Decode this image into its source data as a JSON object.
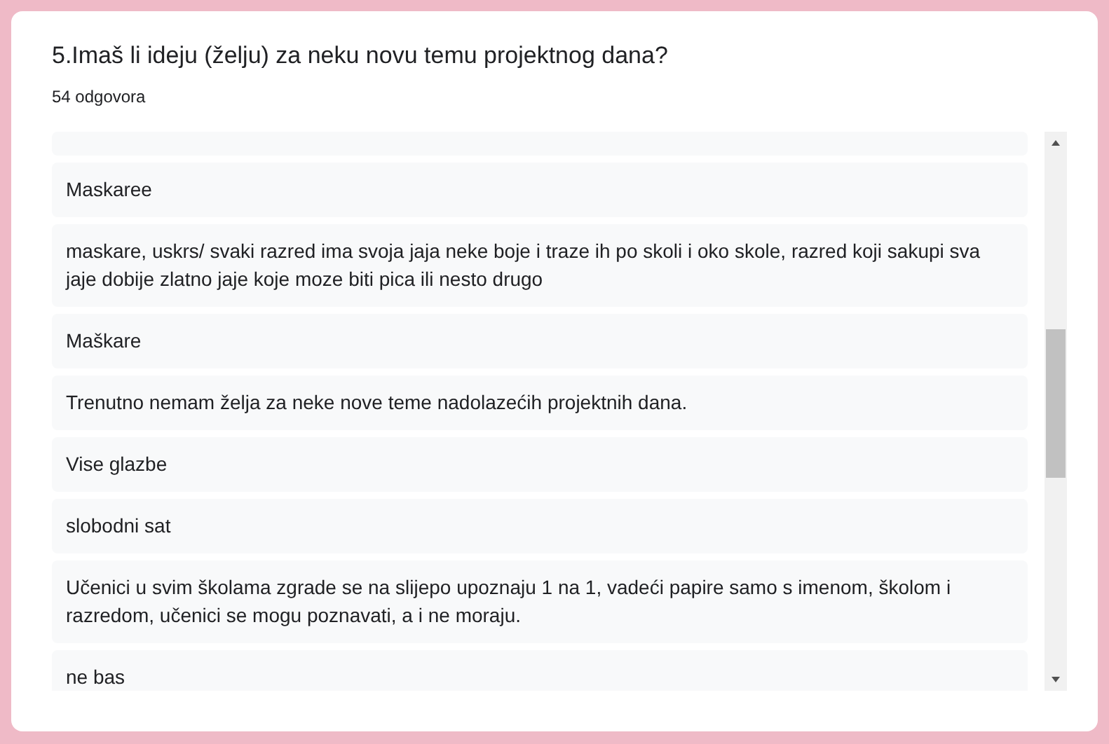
{
  "question": {
    "title": "5.Imaš li ideju (želju) za neku novu temu projektnog dana?",
    "count": "54 odgovora"
  },
  "responses": [
    {
      "text": "Maskaree"
    },
    {
      "text": "maskare, uskrs/ svaki razred ima svoja jaja neke boje i traze ih po skoli i oko skole, razred koji sakupi sva jaje dobije zlatno jaje koje moze biti pica ili nesto drugo"
    },
    {
      "text": "Maškare"
    },
    {
      "text": "Trenutno nemam želja za neke nove teme nadolazećih projektnih dana."
    },
    {
      "text": "Vise glazbe"
    },
    {
      "text": "slobodni sat"
    },
    {
      "text": "Učenici u svim školama zgrade se na slijepo upoznaju 1 na 1, vadeći papire samo s imenom, školom i razredom, učenici se mogu poznavati, a i ne moraju."
    },
    {
      "text": "ne bas"
    }
  ]
}
